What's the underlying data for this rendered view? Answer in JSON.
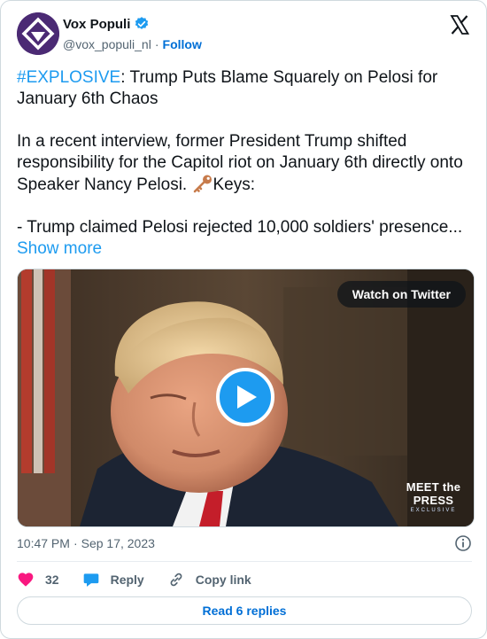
{
  "account": {
    "display_name": "Vox Populi",
    "handle": "@vox_populi_nl",
    "separator": "·",
    "follow_label": "Follow",
    "verified_icon": "verified-badge-icon",
    "avatar_icon": "vox-logo-icon"
  },
  "tweet": {
    "hashtag": "#EXPLOSIVE",
    "headline_rest": ": Trump Puts Blame Squarely on Pelosi for January 6th Chaos",
    "paragraph": "In a recent interview, former President Trump shifted responsibility for the Capitol riot on January 6th directly onto Speaker Nancy Pelosi. ",
    "keys_label": "Keys:",
    "bullet": "- Trump claimed Pelosi rejected 10,000 soldiers' presence...",
    "show_more": "Show more"
  },
  "media": {
    "watch_label": "Watch on Twitter",
    "watermark_title": "MEET the PRESS",
    "watermark_sub": "EXCLUSIVE"
  },
  "meta": {
    "time": "10:47 PM",
    "separator": "·",
    "date": "Sep 17, 2023"
  },
  "actions": {
    "likes": "32",
    "reply_label": "Reply",
    "copy_link_label": "Copy link"
  },
  "replies_button": "Read 6 replies",
  "colors": {
    "accent": "#1d9bf0",
    "link": "#006fd6",
    "like": "#f91880",
    "muted": "#536471"
  }
}
